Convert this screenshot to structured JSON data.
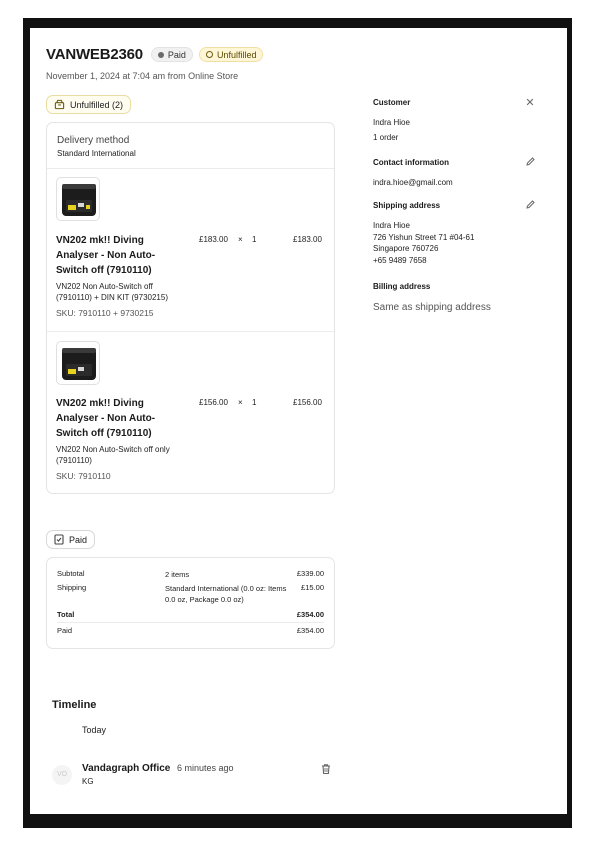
{
  "order": {
    "id": "VANWEB2360",
    "payment_badge": "Paid",
    "fulfillment_badge": "Unfulfilled",
    "subtitle": "November 1, 2024 at 7:04 am from Online Store"
  },
  "fulfillment": {
    "pill_label": "Unfulfilled (2)",
    "delivery_method_title": "Delivery method",
    "delivery_method_value": "Standard International",
    "items": [
      {
        "name": "VN202 mk!! Diving Analyser - Non Auto-Switch off (7910110)",
        "description": "VN202 Non Auto-Switch off (7910110) + DIN KIT (9730215)",
        "sku": "SKU: 7910110 + 9730215",
        "price": "£183.00",
        "qty_sign": "×",
        "qty": "1",
        "total": "£183.00",
        "thumb_icon": "product-case-icon"
      },
      {
        "name": "VN202 mk!! Diving Analyser - Non Auto-Switch off (7910110)",
        "description": "VN202 Non Auto-Switch off only (7910110)",
        "sku": "SKU: 7910110",
        "price": "£156.00",
        "qty_sign": "×",
        "qty": "1",
        "total": "£156.00",
        "thumb_icon": "product-case-icon"
      }
    ]
  },
  "payment": {
    "pill_label": "Paid",
    "rows": [
      {
        "label": "Subtotal",
        "detail": "2 items",
        "amount": "£339.00"
      },
      {
        "label": "Shipping",
        "detail": "Standard International (0.0 oz: Items 0.0 oz, Package 0.0 oz)",
        "amount": "£15.00"
      },
      {
        "label": "Total",
        "detail": "",
        "amount": "£354.00"
      },
      {
        "label": "Paid",
        "detail": "",
        "amount": "£354.00"
      }
    ]
  },
  "customer": {
    "heading": "Customer",
    "name": "Indra Hioe",
    "orders": "1 order",
    "contact_heading": "Contact information",
    "email": "indra.hioe@gmail.com",
    "shipping_heading": "Shipping address",
    "address_lines": [
      "Indra Hioe",
      "726 Yishun Street 71 #04-61",
      "Singapore 760726",
      "+65 9489 7658"
    ],
    "billing_heading": "Billing address",
    "billing_value": "Same as shipping address"
  },
  "timeline": {
    "title": "Timeline",
    "today": "Today",
    "avatar_initials": "VO",
    "event_author": "Vandagraph Office",
    "event_time": "6 minutes ago",
    "event_sub": "KG"
  },
  "colors": {
    "unfulfilled_bg": "#fff6d8",
    "frame": "#111111"
  }
}
